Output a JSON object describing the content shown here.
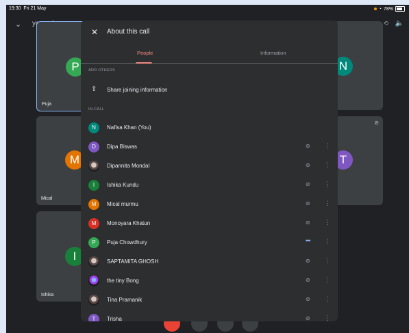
{
  "status_bar": {
    "time": "19:30",
    "date": "Fri 21 May",
    "battery": "78%",
    "wifi_icon": "wifi-icon"
  },
  "top_bar": {
    "meeting_code": "ycp-pchy-oax"
  },
  "tiles": [
    {
      "name": "Puja",
      "initial": "P",
      "color": "#34a853"
    },
    {
      "name": "Mical",
      "initial": "M",
      "color": "#e37400"
    },
    {
      "name": "Ishika",
      "initial": "I",
      "color": "#188038"
    },
    {
      "name": "",
      "initial": "N",
      "color": "#00897b"
    },
    {
      "name": "",
      "initial": "T",
      "color": "#7e57c2"
    }
  ],
  "panel": {
    "title": "About this call",
    "tabs": {
      "people": "People",
      "information": "Information"
    },
    "add_others_label": "ADD OTHERS",
    "share_label": "Share joining information",
    "in_call_label": "IN-CALL",
    "participants": [
      {
        "name": "Nafisa Khan (You)",
        "initial": "N",
        "color": "#00897b",
        "photo": false
      },
      {
        "name": "Dipa Biswas",
        "initial": "D",
        "color": "#7e57c2",
        "photo": false
      },
      {
        "name": "Dipannita Mondal",
        "initial": "",
        "color": "#555555",
        "photo": true
      },
      {
        "name": "Ishika Kundu",
        "initial": "I",
        "color": "#188038",
        "photo": false
      },
      {
        "name": "Mical murmu",
        "initial": "M",
        "color": "#e37400",
        "photo": false
      },
      {
        "name": "Monoyara Khatun",
        "initial": "M",
        "color": "#d93025",
        "photo": false
      },
      {
        "name": "Puja Chowdhury",
        "initial": "P",
        "color": "#34a853",
        "photo": false
      },
      {
        "name": "SAPTAMITA GHOSH",
        "initial": "",
        "color": "#555555",
        "photo": true
      },
      {
        "name": "the tiny Bong",
        "initial": "",
        "color": "#555555",
        "photo": true
      },
      {
        "name": "Tina Pramanik",
        "initial": "",
        "color": "#555555",
        "photo": true
      },
      {
        "name": "Trisha",
        "initial": "T",
        "color": "#7e57c2",
        "photo": false
      }
    ]
  }
}
